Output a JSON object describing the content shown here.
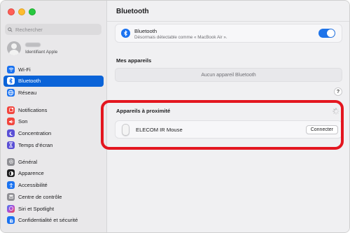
{
  "search": {
    "placeholder": "Rechercher"
  },
  "account": {
    "subtitle": "Identifiant Apple"
  },
  "sidebar": {
    "groups": [
      {
        "items": [
          {
            "label": "Wi-Fi",
            "icon": "wifi-icon",
            "color": "#1a72f0"
          },
          {
            "label": "Bluetooth",
            "icon": "bluetooth-icon",
            "color": "#1a72f0",
            "selected": true
          },
          {
            "label": "Réseau",
            "icon": "globe-icon",
            "color": "#1a72f0"
          }
        ]
      },
      {
        "items": [
          {
            "label": "Notifications",
            "icon": "bell-icon",
            "color": "#f2453d"
          },
          {
            "label": "Son",
            "icon": "speaker-icon",
            "color": "#f2453d"
          },
          {
            "label": "Concentration",
            "icon": "moon-icon",
            "color": "#5a4fd6"
          },
          {
            "label": "Temps d’écran",
            "icon": "hourglass-icon",
            "color": "#5a4fd6"
          }
        ]
      },
      {
        "items": [
          {
            "label": "Général",
            "icon": "gear-icon",
            "color": "#8e8e93"
          },
          {
            "label": "Apparence",
            "icon": "appearance-icon",
            "color": "#1d1d1f"
          },
          {
            "label": "Accessibilité",
            "icon": "accessibility-icon",
            "color": "#1a72f0"
          },
          {
            "label": "Centre de contrôle",
            "icon": "control-center-icon",
            "color": "#8e8e93"
          },
          {
            "label": "Siri et Spotlight",
            "icon": "siri-icon",
            "color": "#b14fd8"
          },
          {
            "label": "Confidentialité et sécurité",
            "icon": "hand-icon",
            "color": "#1a72f0"
          }
        ]
      }
    ]
  },
  "main": {
    "title": "Bluetooth",
    "bluetooth_card": {
      "title": "Bluetooth",
      "subtitle": "Désormais détectable comme « MacBook Air ».",
      "enabled": true
    },
    "my_devices": {
      "label": "Mes appareils",
      "empty_text": "Aucun appareil Bluetooth"
    },
    "help_label": "?",
    "nearby": {
      "label": "Appareils à proximité",
      "devices": [
        {
          "name": "ELECOM IR Mouse",
          "action": "Connecter"
        }
      ]
    }
  },
  "colors": {
    "accent": "#0a63d8",
    "highlight": "#e3161f",
    "toggle_on": "#1f74e9"
  }
}
